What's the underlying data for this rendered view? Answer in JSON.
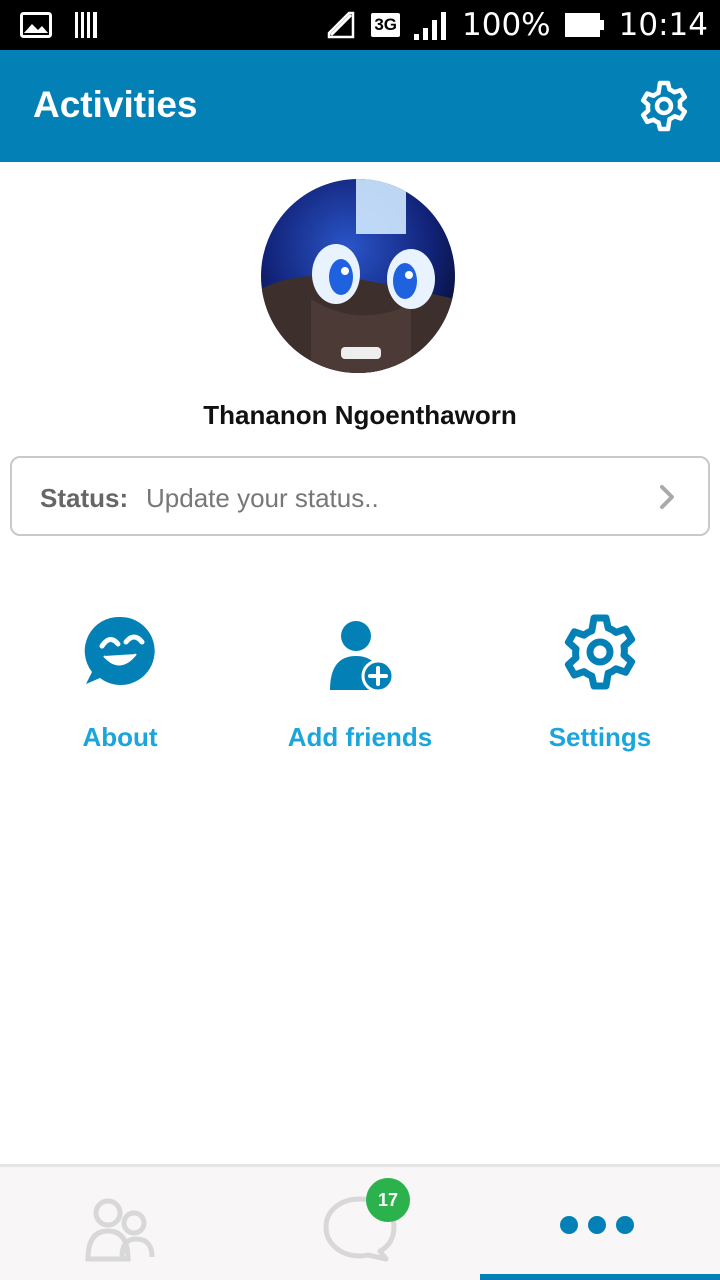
{
  "status_bar": {
    "network": "3G",
    "battery": "100%",
    "time": "10:14"
  },
  "app_bar": {
    "title": "Activities",
    "settings_icon": "gear-icon"
  },
  "profile": {
    "name": "Thananon Ngoenthaworn"
  },
  "status_field": {
    "label": "Status:",
    "placeholder": "Update your status.."
  },
  "actions": [
    {
      "label": "About",
      "icon": "smiley-chat-icon"
    },
    {
      "label": "Add friends",
      "icon": "add-user-icon"
    },
    {
      "label": "Settings",
      "icon": "gear-icon"
    }
  ],
  "bottom_nav": {
    "chats_badge": "17",
    "active_tab": "more"
  },
  "colors": {
    "primary": "#0381b6",
    "accent": "#1aa6dc",
    "badge": "#2bb24c"
  }
}
